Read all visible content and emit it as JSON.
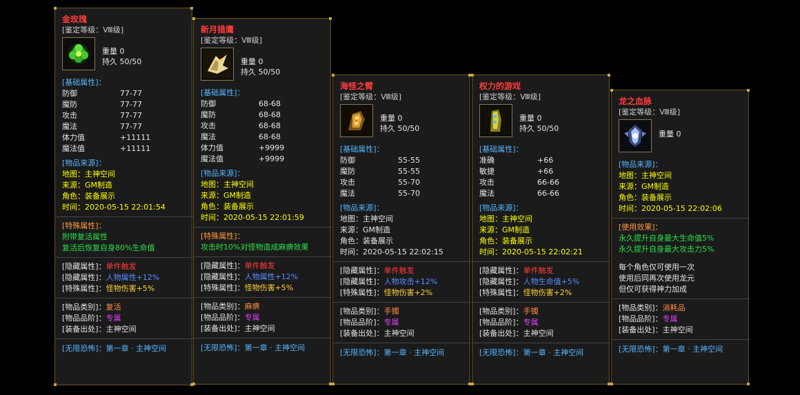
{
  "labels": {
    "weight": "重量",
    "durability": "持久",
    "base_attr": "[基础属性]：",
    "source_title": "[物品来源]：",
    "map": "地图：",
    "origin": "来源：",
    "role": "角色：",
    "time": "时间：",
    "special_title": "[特殊属性]：",
    "use_title": "[使用效果]：",
    "hidden": "[隐藏属性]：",
    "special": "[特殊属性]：",
    "category": "[物品类别]：",
    "rank": "[物品品阶]：",
    "drop": "[装备出处]：",
    "footer": "[无限恐怖]：第一章 · 主神空间"
  },
  "items": [
    {
      "name": "金玫瑰",
      "grade": "[鉴定等级：Ⅷ级]",
      "icon": "green-rose-icon",
      "weight": "0",
      "durability": "50/50",
      "attrs": [
        [
          "防御",
          "77-77"
        ],
        [
          "魔防",
          "77-77"
        ],
        [
          "攻击",
          "77-77"
        ],
        [
          "魔法",
          "77-77"
        ],
        [
          "体力值",
          "+11111"
        ],
        [
          "魔法值",
          "+11111"
        ]
      ],
      "map": "主神空间",
      "origin": "GM制造",
      "role": "装备展示",
      "time": "2020-05-15 22:01:54",
      "effects": [
        "附带复活属性",
        "复活后恢复自身80%生命值"
      ],
      "hidden": "单件触发",
      "hidden2": "人物属性+12%",
      "special": "怪物伤害+5%",
      "category": "复活",
      "rank": "专属",
      "drop": "主神空间"
    },
    {
      "name": "新月猎鹰",
      "grade": "[鉴定等级：Ⅷ级]",
      "icon": "falcon-icon",
      "weight": "0",
      "durability": "50/50",
      "attrs": [
        [
          "防御",
          "68-68"
        ],
        [
          "魔防",
          "68-68"
        ],
        [
          "攻击",
          "68-68"
        ],
        [
          "魔法",
          "68-68"
        ],
        [
          "体力值",
          "+9999"
        ],
        [
          "魔法值",
          "+9999"
        ]
      ],
      "map": "主神空间",
      "origin": "GM制造",
      "role": "装备展示",
      "time": "2020-05-15 22:01:59",
      "effects": [
        "攻击时10%对怪物造成麻痹效果"
      ],
      "hidden": "单件触发",
      "hidden2": "人物属性+12%",
      "special": "怪物伤害+5%",
      "category": "麻痹",
      "rank": "专属",
      "drop": "主神空间"
    },
    {
      "name": "海怪之臂",
      "grade": "[鉴定等级：Ⅷ级]",
      "icon": "bracer-icon",
      "weight": "0",
      "durability": "50/50",
      "attrs": [
        [
          "防御",
          "55-55"
        ],
        [
          "魔防",
          "55-55"
        ],
        [
          "攻击",
          "55-70"
        ],
        [
          "魔法",
          "55-70"
        ]
      ],
      "map": "主神空间",
      "origin": "GM制造",
      "role": "装备展示",
      "time": "2020-05-15 22:02:15",
      "hidden": "单件触发",
      "hidden2": "人物攻击+12%",
      "special": "怪物伤害+2%",
      "category": "手镯",
      "rank": "专属",
      "drop": "主神空间"
    },
    {
      "name": "权力的游戏",
      "grade": "[鉴定等级：Ⅷ级]",
      "icon": "gauntlet-icon",
      "weight": "0",
      "durability": "50/50",
      "attrs": [
        [
          "准确",
          "+66"
        ],
        [
          "敏捷",
          "+66"
        ],
        [
          "攻击",
          "66-66"
        ],
        [
          "魔法",
          "66-66"
        ]
      ],
      "map": "主神空间",
      "origin": "GM制造",
      "role": "装备展示",
      "time": "2020-05-15 22:02:21",
      "hidden": "单件触发",
      "hidden2": "人物生命值+5%",
      "special": "怪物伤害+2%",
      "category": "手镯",
      "rank": "专属",
      "drop": "主神空间"
    },
    {
      "name": "龙之血脉",
      "grade": "[鉴定等级：Ⅷ级]",
      "icon": "dragon-crest-icon",
      "weight": "0",
      "map": "主神空间",
      "origin": "GM制造",
      "role": "装备展示",
      "time": "2020-05-15 22:02:06",
      "effects": [
        "永久提升自身最大生命值5%",
        "永久提升自身最大攻击力5%"
      ],
      "notes": [
        "每个角色仅可使用一次",
        "使用后同再次使用龙元",
        "但仅可获得神力加成"
      ],
      "category": "消耗品",
      "rank": "专属",
      "drop": "主神空间"
    }
  ]
}
